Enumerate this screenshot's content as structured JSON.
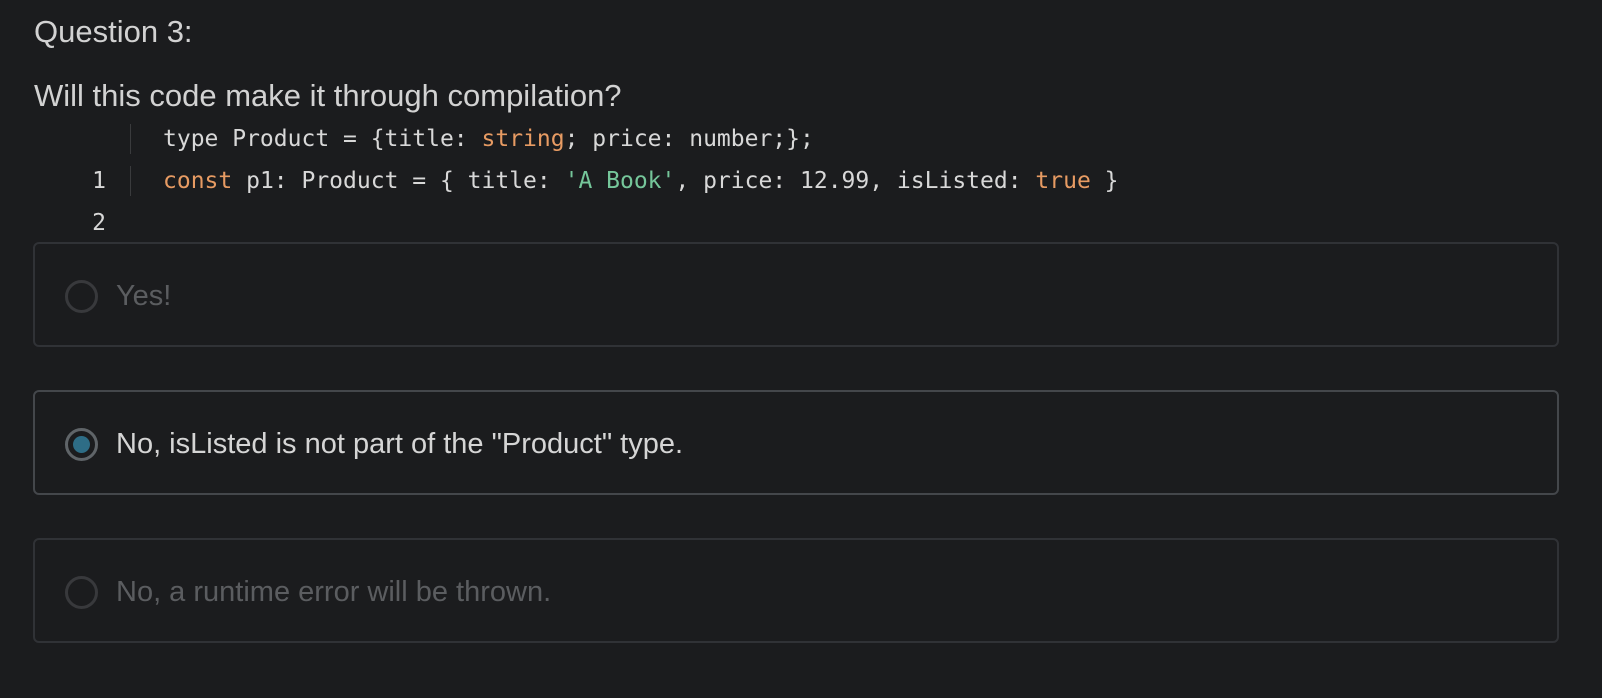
{
  "question": {
    "label": "Question 3:",
    "text": "Will this code make it through compilation?"
  },
  "code": {
    "lines": [
      {
        "number": "1",
        "segments": [
          {
            "text": "type Product = {title: ",
            "kind": "plain"
          },
          {
            "text": "string",
            "kind": "keyword"
          },
          {
            "text": "; price: number;};",
            "kind": "plain"
          }
        ]
      },
      {
        "number": "2",
        "segments": [
          {
            "text": "const",
            "kind": "keyword"
          },
          {
            "text": " p1: Product = { title: ",
            "kind": "plain"
          },
          {
            "text": "'A Book'",
            "kind": "string"
          },
          {
            "text": ", price: 12.99, isListed: ",
            "kind": "plain"
          },
          {
            "text": "true",
            "kind": "keyword"
          },
          {
            "text": " }",
            "kind": "plain"
          }
        ]
      }
    ]
  },
  "options": [
    {
      "label": "Yes!",
      "selected": false
    },
    {
      "label": "No, isListed is not part of the \"Product\" type.",
      "selected": true
    },
    {
      "label": "No, a runtime error will be thrown.",
      "selected": false
    }
  ],
  "colors": {
    "background": "#1b1c1e",
    "keyword": "#e79b63",
    "string": "#75c69a",
    "radio_selected": "#2e6d86"
  }
}
